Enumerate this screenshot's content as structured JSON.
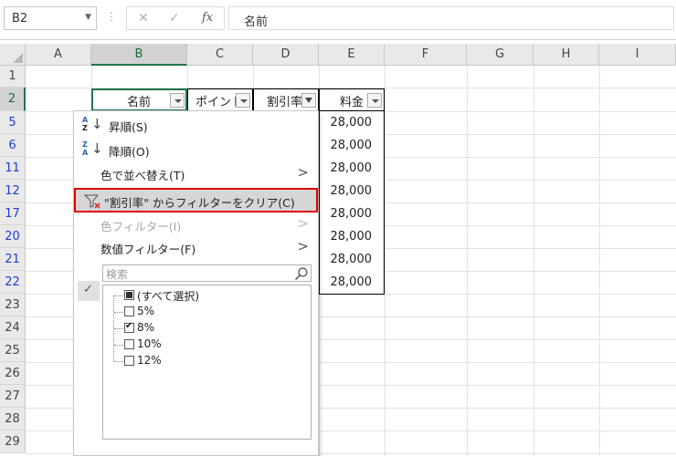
{
  "formula_bar": {
    "name_box": "B2",
    "dots": "⋮",
    "cancel_glyph": "✕",
    "enter_glyph": "✓",
    "fx_glyph": "fx",
    "formula_value": "名前"
  },
  "columns": [
    "A",
    "B",
    "C",
    "D",
    "E",
    "F",
    "G",
    "H",
    "I"
  ],
  "rows": [
    "1",
    "2",
    "5",
    "6",
    "11",
    "12",
    "17",
    "20",
    "21",
    "22",
    "23",
    "24",
    "25",
    "26",
    "27",
    "28",
    "29"
  ],
  "table": {
    "headers": [
      "名前",
      "ポイント",
      "割引率",
      "料金"
    ],
    "fee_values": [
      "28,000",
      "28,000",
      "28,000",
      "28,000",
      "28,000",
      "28,000",
      "28,000",
      "28,000"
    ]
  },
  "menu": {
    "sort_asc_icon_top": "A",
    "sort_asc_icon_bottom": "Z",
    "sort_desc_icon_top": "Z",
    "sort_desc_icon_bottom": "A",
    "sort_arrow": "↓",
    "sort_asc": "昇順(S)",
    "sort_desc": "降順(O)",
    "sort_by_color": "色で並べ替え(T)",
    "clear_filter": "\"割引率\" からフィルターをクリア(C)",
    "color_filter": "色フィルター(I)",
    "number_filter": "数値フィルター(F)",
    "submenu_arrow": ">",
    "search_placeholder": "検索",
    "checkmark": "✓",
    "list_items": [
      {
        "label": "(すべて選択)",
        "state": "partial"
      },
      {
        "label": "5%",
        "state": "off"
      },
      {
        "label": "8%",
        "state": "on"
      },
      {
        "label": "10%",
        "state": "off"
      },
      {
        "label": "12%",
        "state": "off"
      }
    ]
  },
  "colors": {
    "selection_green": "#217346",
    "filtered_row_blue": "#1f3fcf",
    "highlight_red": "#e00000"
  }
}
